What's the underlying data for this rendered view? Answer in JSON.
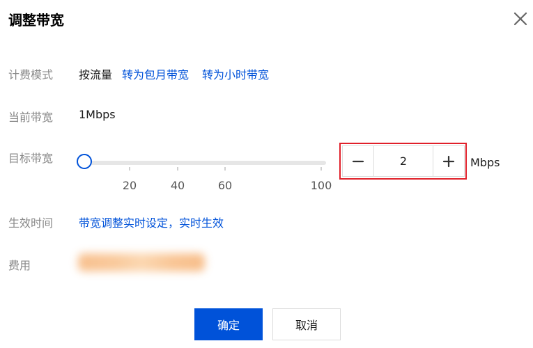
{
  "dialog": {
    "title": "调整带宽",
    "close_icon": "close-icon"
  },
  "billing": {
    "label": "计费模式",
    "value": "按流量",
    "link_monthly": "转为包月带宽",
    "link_hourly": "转为小时带宽"
  },
  "current_bandwidth": {
    "label": "当前带宽",
    "value": "1Mbps"
  },
  "target_bandwidth": {
    "label": "目标带宽",
    "slider": {
      "min": 1,
      "max": 100,
      "value": 2,
      "ticks": [
        "20",
        "40",
        "60",
        "100"
      ]
    },
    "stepper": {
      "value": "2",
      "minus_icon": "minus-icon",
      "plus_icon": "plus-icon"
    },
    "unit": "Mbps"
  },
  "effective_time": {
    "label": "生效时间",
    "value": "带宽调整实时设定，实时生效"
  },
  "fee": {
    "label": "费用"
  },
  "footer": {
    "ok_label": "确定",
    "cancel_label": "取消"
  },
  "colors": {
    "primary": "#0052d9",
    "highlight": "#e0202a",
    "label": "#888888"
  }
}
